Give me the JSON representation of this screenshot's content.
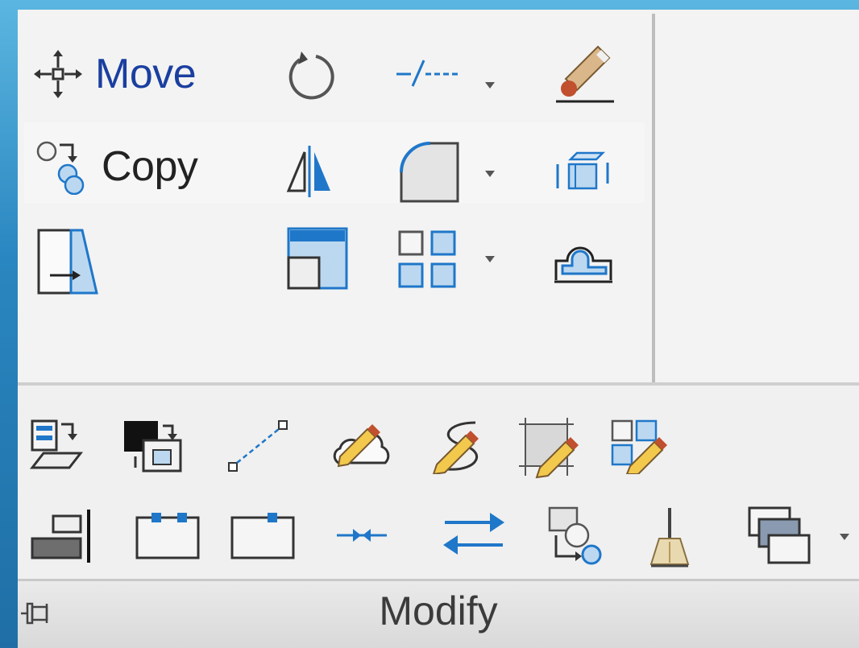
{
  "panel": {
    "title": "Modify"
  },
  "upper_tools": {
    "move_label": "Move",
    "copy_label": "Copy"
  },
  "colors": {
    "accent_blue": "#1f77c9",
    "panel_bg": "#f3f3f3",
    "frame_blue": "#2a86c0"
  },
  "icons": {
    "upper_row1": [
      "move-icon",
      "rotate-icon",
      "trim-icon",
      "erase-icon"
    ],
    "upper_row2": [
      "copy-icon",
      "mirror-icon",
      "fillet-icon",
      "explode-icon"
    ],
    "upper_row3": [
      "stretch-icon",
      "scale-icon",
      "array-icon",
      "offset-icon"
    ],
    "lower_row1": [
      "edit-attribute-icon",
      "block-editor-icon",
      "polyline-edit-icon",
      "revcloud-icon",
      "spline-edit-icon",
      "hatch-edit-icon",
      "array-edit-icon"
    ],
    "lower_row2": [
      "align-icon",
      "lengthen-icon",
      "break-icon",
      "join-icon",
      "reverse-icon",
      "set-by-layer-icon",
      "purge-icon",
      "draw-order-icon"
    ]
  }
}
